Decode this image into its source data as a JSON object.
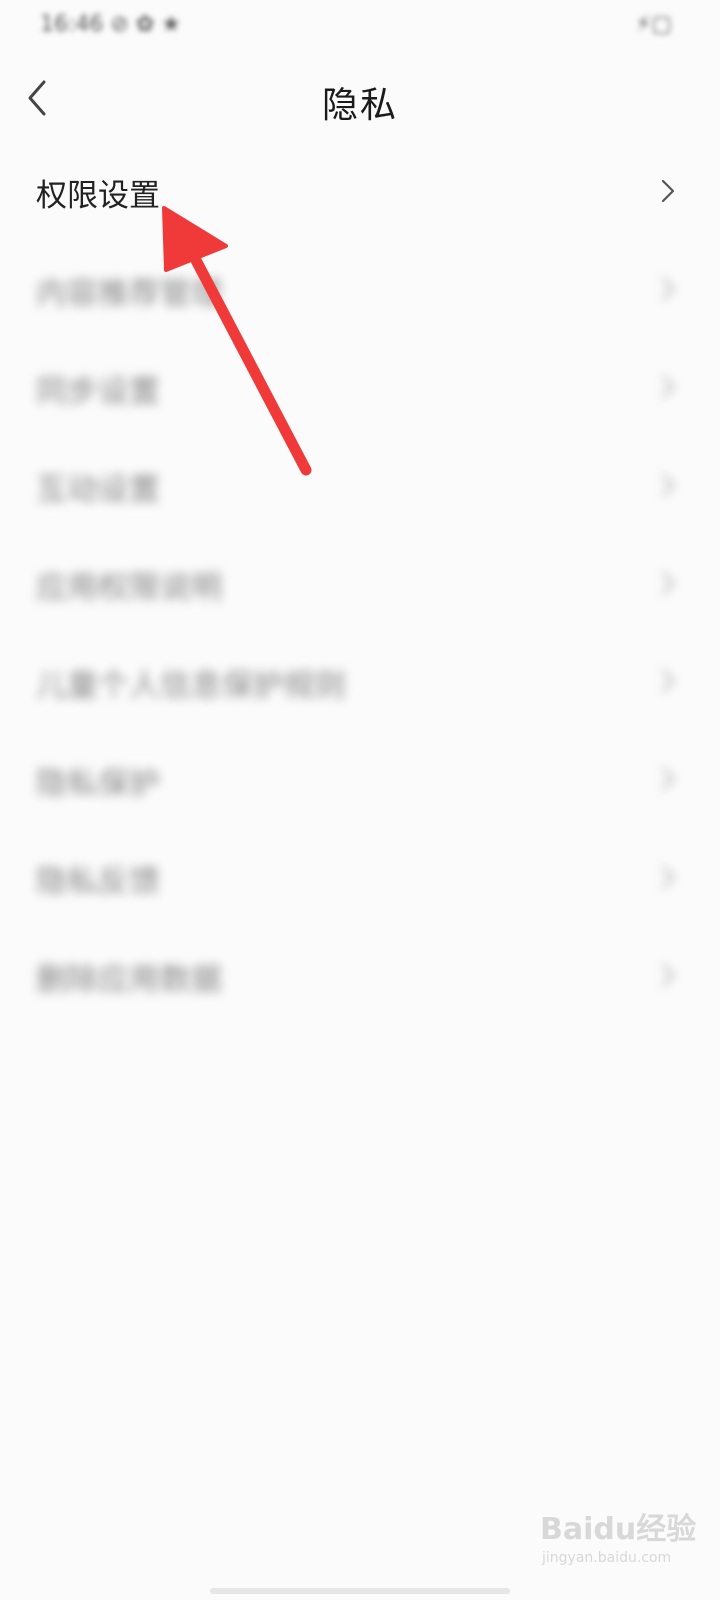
{
  "status_bar": {
    "left_text": "16:46 ⊘ ✿ ★",
    "right_text": "⚡▢"
  },
  "header": {
    "title": "隐私",
    "back_icon": "chevron-left-icon"
  },
  "menu": {
    "items": [
      {
        "label": "权限设置",
        "blurred": false
      },
      {
        "label": "内容推荐管理",
        "blurred": true
      },
      {
        "label": "同步设置",
        "blurred": true
      },
      {
        "label": "互动设置",
        "blurred": true
      },
      {
        "label": "应用权限说明",
        "blurred": true
      },
      {
        "label": "儿童个人信息保护规则",
        "blurred": true
      },
      {
        "label": "隐私保护",
        "blurred": true
      },
      {
        "label": "隐私反馈",
        "blurred": true
      },
      {
        "label": "删除应用数据",
        "blurred": true
      }
    ],
    "chevron_icon": "chevron-right-icon"
  },
  "annotation": {
    "arrow_color": "#f03a3a"
  },
  "watermark": {
    "logo": "Baidu经验",
    "url": "jingyan.baidu.com"
  }
}
